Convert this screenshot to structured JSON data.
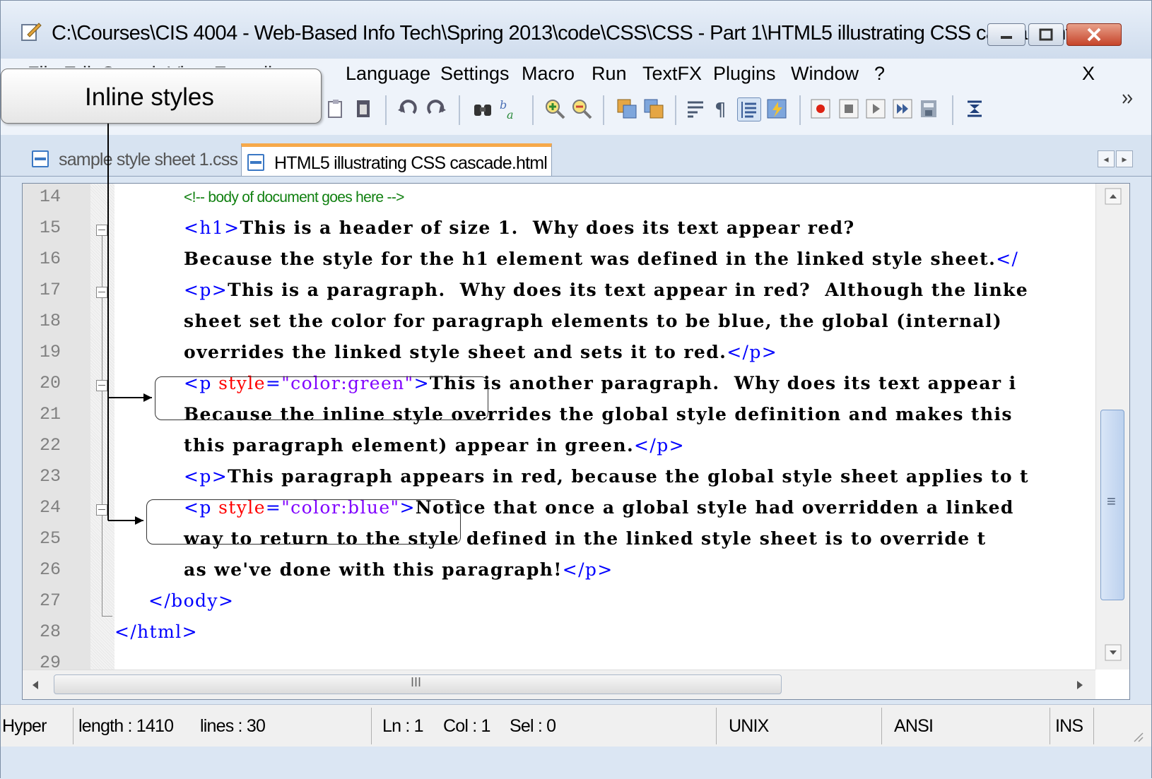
{
  "window": {
    "title": "C:\\Courses\\CIS 4004 - Web-Based Info Tech\\Spring 2013\\code\\CSS\\CSS - Part 1\\HTML5 illustrating CSS cascade.html ..."
  },
  "menu": {
    "partial_left": "File  Edit  Search  View  Encoding",
    "items": [
      "Language",
      "Settings",
      "Macro",
      "Run",
      "TextFX",
      "Plugins",
      "Window",
      "?"
    ],
    "close_x": "X"
  },
  "tabs": [
    {
      "label": "sample style sheet 1.css",
      "active": false
    },
    {
      "label": "HTML5 illustrating CSS cascade.html",
      "active": true
    }
  ],
  "editor": {
    "lines": [
      {
        "num": "14",
        "comment": "<!-- body of document goes here -->"
      },
      {
        "num": "15"
      },
      {
        "num": "16"
      },
      {
        "num": "17"
      },
      {
        "num": "18"
      },
      {
        "num": "19"
      },
      {
        "num": "20"
      },
      {
        "num": "21"
      },
      {
        "num": "22"
      },
      {
        "num": "23"
      },
      {
        "num": "24"
      },
      {
        "num": "25"
      },
      {
        "num": "26"
      },
      {
        "num": "27"
      },
      {
        "num": "28"
      },
      {
        "num": "29"
      }
    ],
    "code": {
      "l15_tag": "<h1>",
      "l15_text": "This is a header of size 1.  Why does its text appear red?",
      "l16_text": "Because the style for the h1 element was defined in the linked style sheet.",
      "l16_tag": "</",
      "l17_tag": "<p>",
      "l17_text": "This is a paragraph.  Why does its text appear in red?  Although the linke",
      "l18_text": "sheet set the color for paragraph elements to be blue, the global (internal)",
      "l19_text": "overrides the linked style sheet and sets it to red.",
      "l19_tag": "</p>",
      "l20_tag_open": "<p ",
      "l20_attr": "style",
      "l20_eq": "=",
      "l20_val": "\"color:green\"",
      "l20_tag_close": ">",
      "l20_text": "This is another paragraph.  Why does its text appear i",
      "l21_text": "Because the inline style overrides the global style definition and makes this",
      "l22_text": "this paragraph element) appear in green.",
      "l22_tag": "</p>",
      "l23_tag": "<p>",
      "l23_text": "This paragraph appears in red, because the global style sheet applies to t",
      "l24_tag_open": "<p ",
      "l24_attr": "style",
      "l24_eq": "=",
      "l24_val": "\"color:blue\"",
      "l24_tag_close": ">",
      "l24_text": "Notice that once a global style had overridden a linked",
      "l25_text": "way to return to the style defined in the linked style sheet is to override t",
      "l26_text": "as we've done with this paragraph!",
      "l26_tag": "</p>",
      "l27_tag": "</body>",
      "l28_tag": "</html>"
    }
  },
  "scroll": {
    "h_grip": "III",
    "v_grip": "≡"
  },
  "status": {
    "mode": "Hyper",
    "length": "length : 1410",
    "lines": "lines : 30",
    "ln": "Ln : 1",
    "col": "Col : 1",
    "sel": "Sel : 0",
    "eol": "UNIX",
    "encoding": "ANSI",
    "ins": "INS"
  },
  "annotation": {
    "label": "Inline styles"
  },
  "colors": {
    "tag": "#0000ff",
    "attr": "#ff0000",
    "value": "#8000ff",
    "comment": "#108010",
    "active_tab_accent": "#f7a94a"
  },
  "icons": [
    "app-notepad-icon",
    "minimize-icon",
    "maximize-icon",
    "close-icon",
    "paste-icon",
    "undo-icon",
    "redo-icon",
    "find-icon",
    "replace-icon",
    "zoom-in-icon",
    "zoom-out-icon",
    "sync-v-icon",
    "sync-h-icon",
    "wrap-icon",
    "pilcrow-icon",
    "indent-guide-icon",
    "macro-record-icon",
    "macro-stop-icon",
    "macro-play-icon",
    "macro-run-multiple-icon",
    "macro-save-icon",
    "trim-icon"
  ]
}
